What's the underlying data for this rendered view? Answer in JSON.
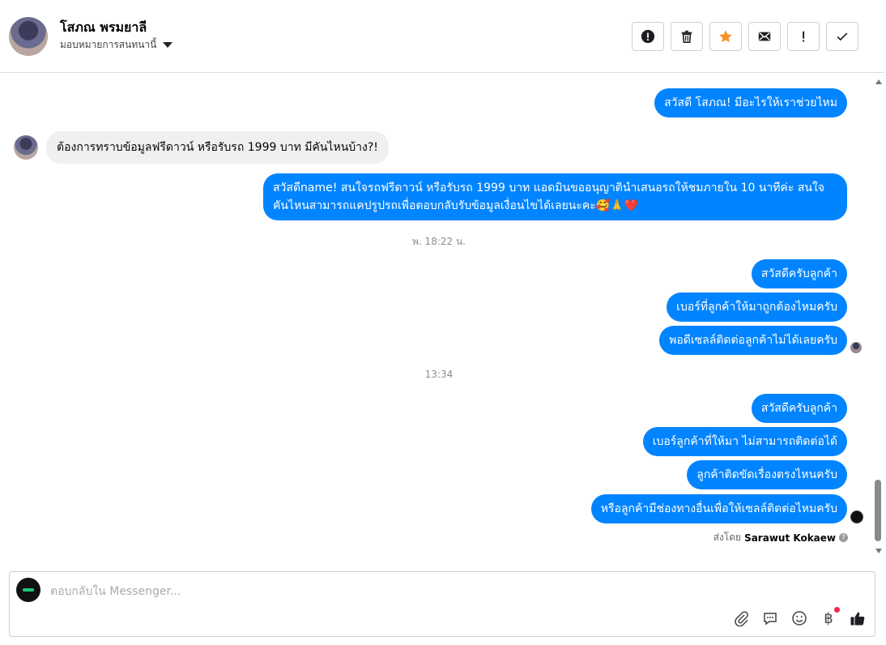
{
  "header": {
    "contact_name": "โสภณ พรมยาลี",
    "assignment": "มอบหมายการสนทนานี้",
    "actions": [
      {
        "name": "spam-button",
        "icon": "alert-circle-icon"
      },
      {
        "name": "delete-button",
        "icon": "trash-icon"
      },
      {
        "name": "star-button",
        "icon": "star-icon"
      },
      {
        "name": "mark-unread-button",
        "icon": "envelope-icon"
      },
      {
        "name": "follow-up-button",
        "icon": "exclamation-icon"
      },
      {
        "name": "mark-done-button",
        "icon": "check-icon"
      }
    ],
    "star_color": "#f5922c"
  },
  "thread": {
    "messages": [
      {
        "from": "page",
        "text": "สวัสดี โสภณ! มีอะไรให้เราช่วยไหม"
      },
      {
        "from": "user",
        "text": "ต้องการทราบข้อมูลฟรีดาวน์ หรือรับรถ 1999 บาท มีคันไหนบ้าง?!"
      },
      {
        "from": "page",
        "text": "สวัสดีname! สนใจรถฟรีดาวน์ หรือรับรถ 1999 บาท แอดมินขออนุญาตินำเสนอรถให้ชมภายใน 10 นาทีค่ะ สนใจคันไหนสามารถแคปรูปรถเพื่อตอบกลับรับข้อมูลเงื่อนไขได้เลยนะคะ🥰🙏❤️"
      },
      {
        "from": "page",
        "text": "สวัสดีครับลูกค้า"
      },
      {
        "from": "page",
        "text": "เบอร์ที่ลูกค้าให้มาถูกต้องไหมครับ"
      },
      {
        "from": "page",
        "text": "พอดีเซลล์ติดต่อลูกค้าไม่ได้เลยครับ"
      },
      {
        "from": "page",
        "text": "สวัสดีครับลูกค้า"
      },
      {
        "from": "page",
        "text": "เบอร์ลูกค้าที่ให้มา ไม่สามารถติดต่อได้"
      },
      {
        "from": "page",
        "text": "ลูกค้าติดขัดเรื่องตรงไหนครับ"
      },
      {
        "from": "page",
        "text": "หรือลูกค้ามีช่องทางอื่นเพื่อให้เซลล์ติดต่อไหมครับ"
      }
    ],
    "timestamps": [
      "พ. 18:22 น.",
      "13:34"
    ],
    "sent_by_label": "ส่งโดย",
    "sent_by_name": "Sarawut Kokaew",
    "bubble_color": "#0084ff"
  },
  "composer": {
    "placeholder": "ตอบกลับใน Messenger...",
    "value": "",
    "tools": [
      "attachment-icon",
      "saved-replies-icon",
      "emoji-icon",
      "payment-icon",
      "like-icon"
    ]
  }
}
